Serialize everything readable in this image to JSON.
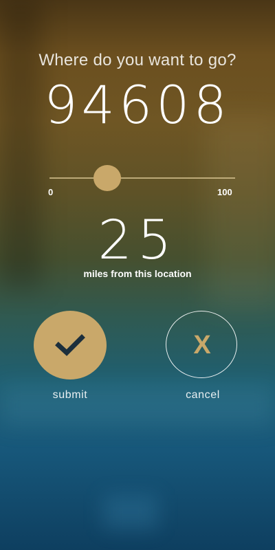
{
  "header": {
    "question": "Where do you want to go?"
  },
  "zip": {
    "value": "94608"
  },
  "distance_slider": {
    "min_label": "0",
    "max_label": "100",
    "value": 25,
    "min": 0,
    "max": 100
  },
  "distance": {
    "value": "25",
    "label": "miles from this location"
  },
  "actions": {
    "submit_label": "submit",
    "submit_icon": "checkmark-icon",
    "cancel_label": "cancel",
    "cancel_glyph": "X",
    "cancel_icon": "x-icon"
  },
  "colors": {
    "accent": "#c9a86a",
    "check": "#1c2f3c"
  }
}
